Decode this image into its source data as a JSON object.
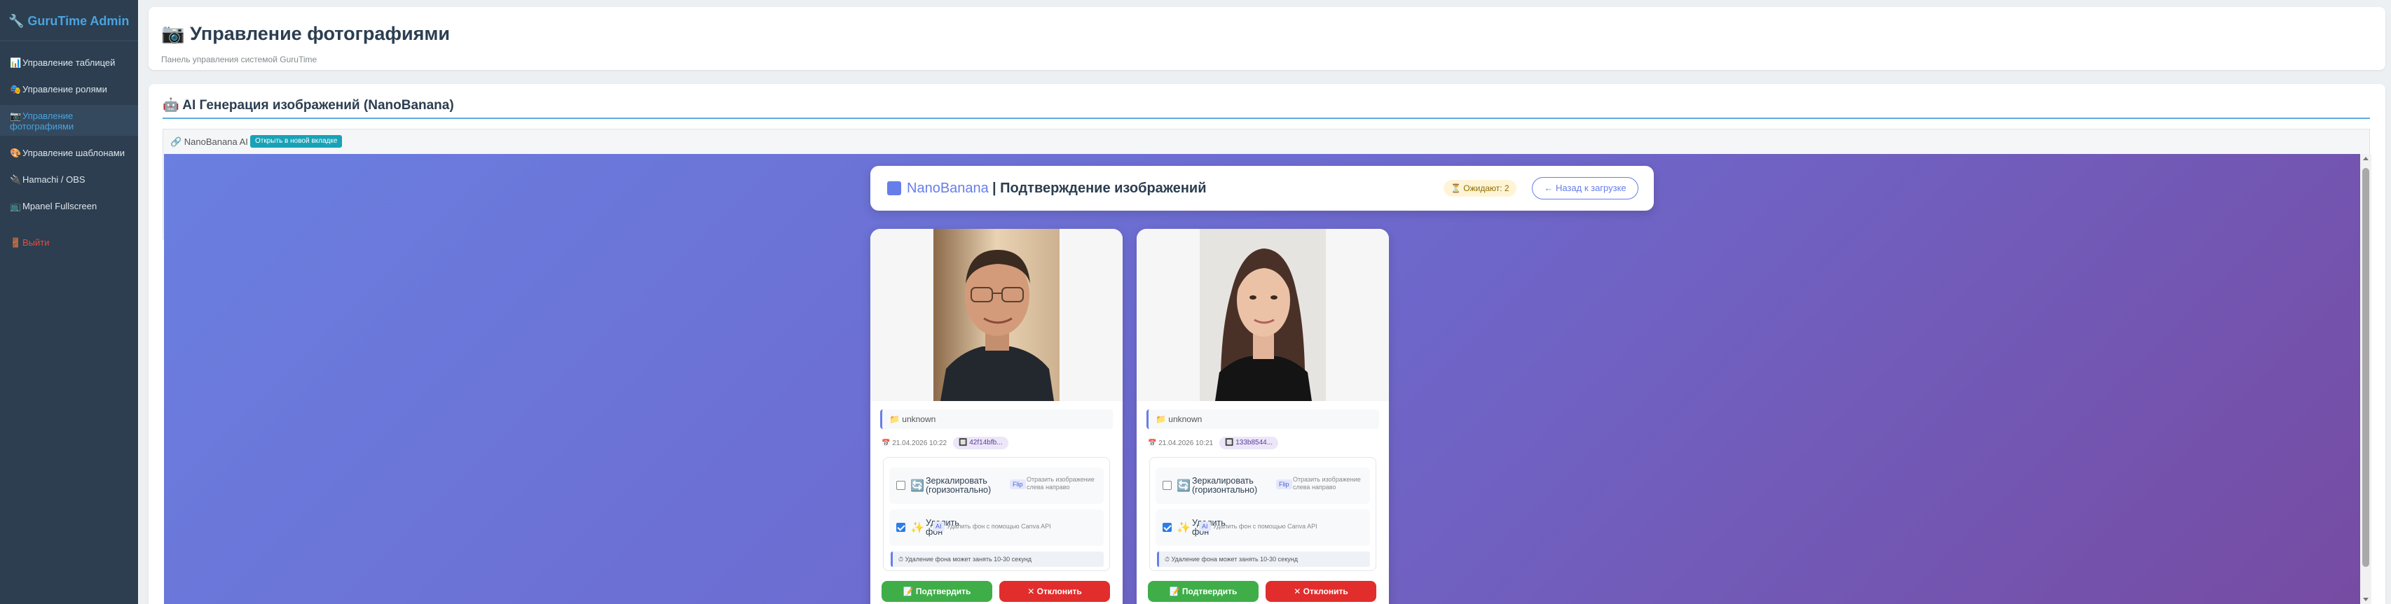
{
  "sidebar": {
    "brand": "🔧 GuruTime Admin",
    "items": [
      {
        "icon": "📊",
        "label": "Управление таблицей"
      },
      {
        "icon": "🎭",
        "label": "Управление ролями"
      },
      {
        "icon": "📷",
        "label": "Управление фотографиями"
      },
      {
        "icon": "🎨",
        "label": "Управление шаблонами"
      },
      {
        "icon": "🔌",
        "label": "Hamachi / OBS"
      },
      {
        "icon": "📺",
        "label": "Mpanel Fullscreen"
      }
    ],
    "logout": {
      "icon": "🚪",
      "label": "Выйти"
    }
  },
  "header": {
    "icon": "📷",
    "title": "Управление фотографиями",
    "subtitle": "Панель управления системой GuruTime"
  },
  "section": {
    "title": "🤖 AI Генерация изображений (NanoBanana)",
    "frame_label": "🔗 NanoBanana AI",
    "open_new_tab": "Открыть в новой вкладке"
  },
  "nanobanana": {
    "brand": "NanoBanana",
    "title": "| Подтверждение изображений",
    "pending": "⏳ Ожидают: 2",
    "back_button": "← Назад к загрузке"
  },
  "cards": [
    {
      "folder": "📁 unknown",
      "date": "📅 21.04.2026 10:22",
      "id": "🔲 42f14bfb...",
      "options": {
        "mirror_label": "Зеркалировать (горизонтально)",
        "mirror_tag": "Flip",
        "mirror_desc": "Отразить изображение слева направо",
        "mirror_checked": false,
        "removebg_label": "Удалить фон",
        "removebg_tag": "AI",
        "removebg_desc": "Удалить фон с помощью Canva API",
        "removebg_checked": true,
        "note": "⏱ Удаление фона может занять 10-30 секунд"
      },
      "confirm": "📝 Подтвердить",
      "reject": "✕ Отклонить"
    },
    {
      "folder": "📁 unknown",
      "date": "📅 21.04.2026 10:21",
      "id": "🔲 133b8544...",
      "options": {
        "mirror_label": "Зеркалировать (горизонтально)",
        "mirror_tag": "Flip",
        "mirror_desc": "Отразить изображение слева направо",
        "mirror_checked": false,
        "removebg_label": "Удалить фон",
        "removebg_tag": "AI",
        "removebg_desc": "Удалить фон с помощью Canva API",
        "removebg_checked": true,
        "note": "⏱ Удаление фона может занять 10-30 секунд"
      },
      "confirm": "📝 Подтвердить",
      "reject": "✕ Отклонить"
    }
  ],
  "colors": {
    "sidebar_bg": "#2c3e50",
    "accent": "#667eea",
    "confirm": "#3fae49",
    "reject": "#e22d2d"
  }
}
